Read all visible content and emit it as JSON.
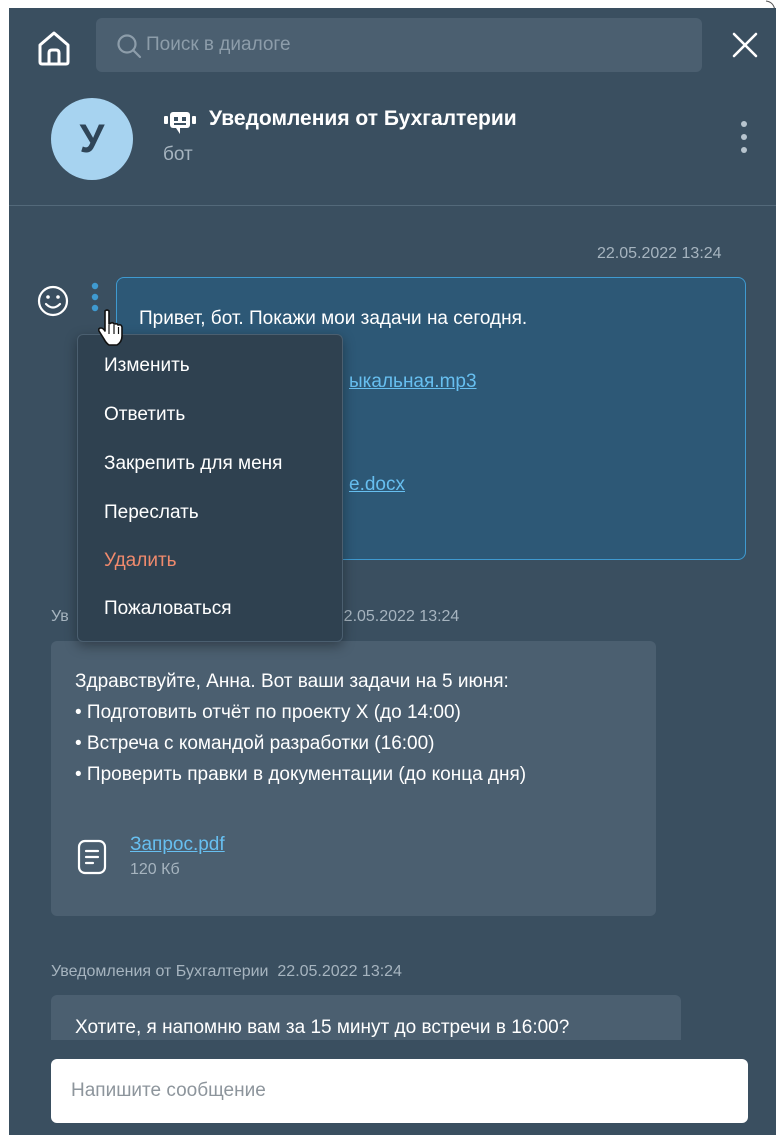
{
  "search": {
    "placeholder": "Поиск в диалоге"
  },
  "chat": {
    "avatar_letter": "У",
    "title": "Уведомления от Бухгалтерии",
    "subtitle": "бот"
  },
  "outgoing": {
    "timestamp": "22.05.2022  13:24",
    "text": "Привет, бот. Покажи мои задачи на сегодня.",
    "link1_visible": "ыкальная.mp3",
    "link2_visible": "e.docx"
  },
  "context_menu": {
    "items": [
      {
        "label": "Изменить"
      },
      {
        "label": "Ответить"
      },
      {
        "label": "Закрепить для меня"
      },
      {
        "label": "Переслать"
      },
      {
        "label": "Удалить",
        "danger": true
      },
      {
        "label": "Пожаловаться"
      }
    ]
  },
  "incoming1": {
    "sender_prefix": "Ув",
    "timestamp": "22.05.2022  13:24",
    "lines": [
      "Здравствуйте, Анна. Вот ваши задачи на 5 июня:",
      "• Подготовить отчёт по проекту X (до 14:00)",
      "• Встреча с командой разработки (16:00)",
      "• Проверить правки в документации (до конца дня)"
    ],
    "file": {
      "name": "Запрос.pdf",
      "size": "120 Кб"
    }
  },
  "incoming2": {
    "sender": "Уведомления от Бухгалтерии",
    "timestamp": "22.05.2022  13:24",
    "text": "Хотите, я напомню вам за 15 минут до встречи в 16:00?"
  },
  "composer": {
    "placeholder": "Напишите сообщение"
  },
  "colors": {
    "background": "#3a4f60",
    "bubble_in": "#4b5f70",
    "bubble_out": "#2d5876",
    "accent": "#3f9ad0",
    "link": "#67bff0",
    "danger": "#f08a6d",
    "avatar": "#a7d3f0"
  }
}
